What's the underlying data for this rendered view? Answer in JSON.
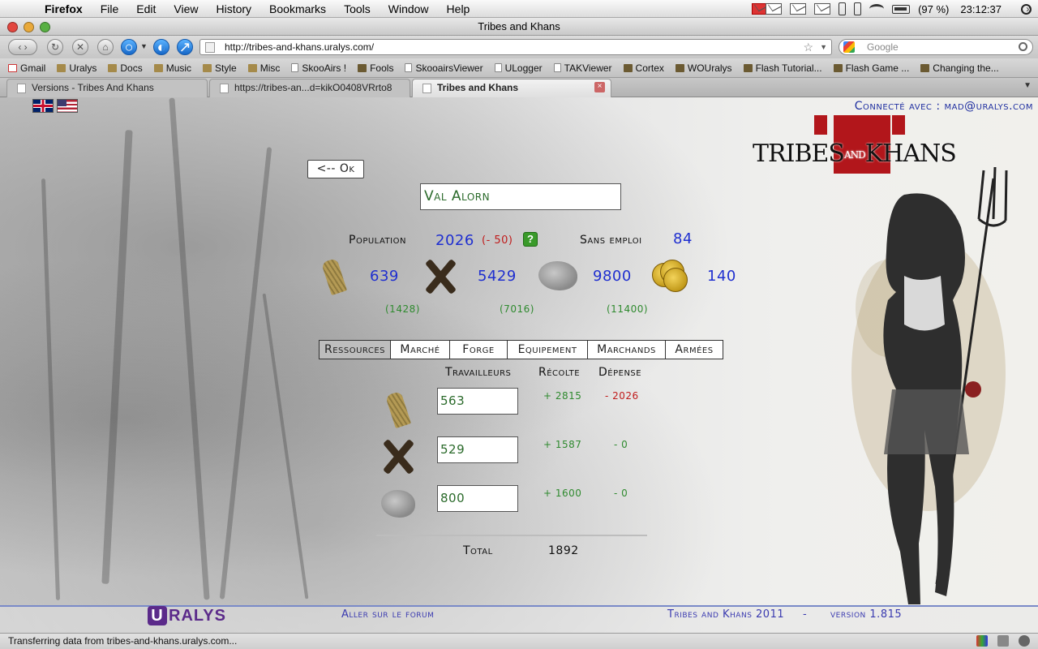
{
  "menubar": {
    "app": "Firefox",
    "items": [
      "File",
      "Edit",
      "View",
      "History",
      "Bookmarks",
      "Tools",
      "Window",
      "Help"
    ],
    "mail_count": "2",
    "battery": "(97 %)",
    "clock": "23:12:37"
  },
  "window": {
    "title": "Tribes and Khans"
  },
  "nav": {
    "url": "http://tribes-and-khans.uralys.com/",
    "search_placeholder": "Google"
  },
  "bookmarks": [
    {
      "label": "Gmail",
      "icon": "gmail-icon"
    },
    {
      "label": "Uralys",
      "icon": "folder-icon"
    },
    {
      "label": "Docs",
      "icon": "folder-icon"
    },
    {
      "label": "Music",
      "icon": "folder-icon"
    },
    {
      "label": "Style",
      "icon": "folder-icon"
    },
    {
      "label": "Misc",
      "icon": "folder-icon"
    },
    {
      "label": "SkooAirs !",
      "icon": "page-icon"
    },
    {
      "label": "Fools",
      "icon": "favicon-icon"
    },
    {
      "label": "SkooairsViewer",
      "icon": "page-icon"
    },
    {
      "label": "ULogger",
      "icon": "page-icon"
    },
    {
      "label": "TAKViewer",
      "icon": "page-icon"
    },
    {
      "label": "Cortex",
      "icon": "favicon-icon"
    },
    {
      "label": "WOUralys",
      "icon": "favicon-icon"
    },
    {
      "label": "Flash Tutorial...",
      "icon": "favicon-icon"
    },
    {
      "label": "Flash Game ...",
      "icon": "favicon-icon"
    },
    {
      "label": "Changing the...",
      "icon": "favicon-icon"
    }
  ],
  "tabs": [
    {
      "label": "Versions - Tribes And Khans"
    },
    {
      "label": "https://tribes-an...d=kikO0408VRrto8"
    },
    {
      "label": "Tribes and Khans"
    }
  ],
  "game": {
    "connected": "Connecté avec : mad@uralys.com",
    "logo_left": "TRIBES",
    "logo_and": "AND",
    "logo_right": "KHANS",
    "back_button": "<-- Ok",
    "city_name": "Val Alorn",
    "population_label": "Population",
    "population_value": "2026",
    "population_delta": "(- 50)",
    "unemployed_label": "Sans emploi",
    "unemployed_value": "84",
    "resources": [
      {
        "icon": "wheat-icon",
        "value": "639",
        "capacity": "(1428)"
      },
      {
        "icon": "wood-icon",
        "value": "5429",
        "capacity": "(7016)"
      },
      {
        "icon": "stone-icon",
        "value": "9800",
        "capacity": "(11400)"
      },
      {
        "icon": "gold-coins-icon",
        "value": "140",
        "capacity": ""
      }
    ],
    "tabs": [
      "Ressources",
      "Marché",
      "Forge",
      "Equipement",
      "Marchands",
      "Armées"
    ],
    "table_headers": {
      "workers": "Travailleurs",
      "harvest": "Récolte",
      "spending": "Dépense"
    },
    "rows": [
      {
        "icon": "wheat-icon",
        "workers": "563",
        "harvest": "+ 2815",
        "spending": "- 2026"
      },
      {
        "icon": "wood-icon",
        "workers": "529",
        "harvest": "+ 1587",
        "spending": "- 0"
      },
      {
        "icon": "stone-icon",
        "workers": "800",
        "harvest": "+ 1600",
        "spending": "- 0"
      }
    ],
    "total_label": "Total",
    "total_value": "1892",
    "footer_logo": "RALYS",
    "footer_logo_letter": "U",
    "forum_link": "Aller sur le forum",
    "footer_game": "Tribes and Khans 2011",
    "footer_sep": "-",
    "footer_version": "version 1.815"
  },
  "status": {
    "text": "Transferring data from tribes-and-khans.uralys.com..."
  },
  "colors": {
    "link_blue": "#1f2fd0",
    "green": "#2f8a2f",
    "red": "#c01b1b",
    "logo_red": "#b2161b"
  }
}
